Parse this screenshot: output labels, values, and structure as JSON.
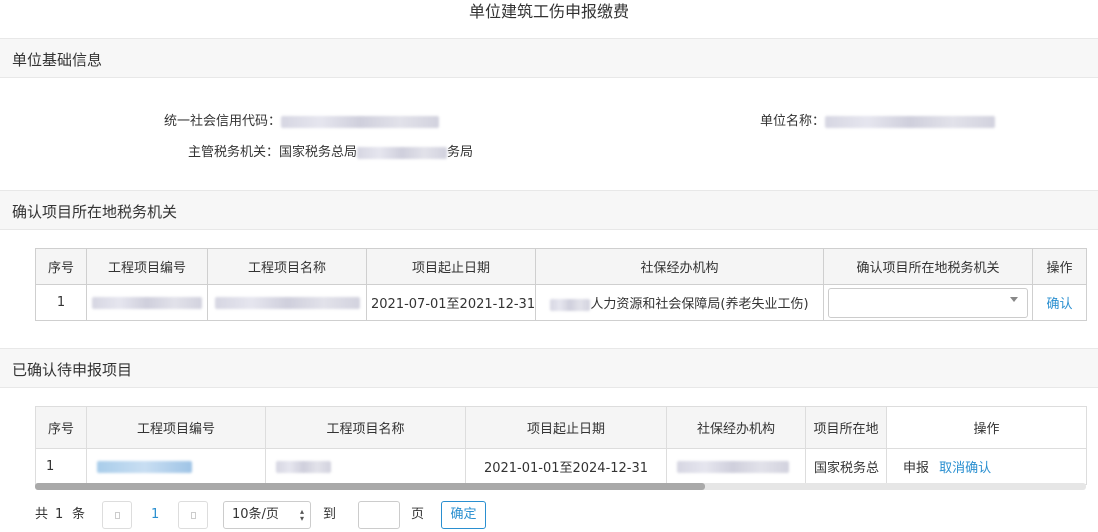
{
  "page_title": "单位建筑工伤申报缴费",
  "section_basic": {
    "title": "单位基础信息",
    "credit_code_label": "统一社会信用代码：",
    "unit_name_label": "单位名称：",
    "tax_authority_label": "主管税务机关：",
    "tax_authority_prefix": "国家税务总局",
    "tax_authority_suffix": "务局"
  },
  "section_confirm": {
    "title": "确认项目所在地税务机关",
    "columns": [
      "序号",
      "工程项目编号",
      "工程项目名称",
      "项目起止日期",
      "社保经办机构",
      "确认项目所在地税务机关",
      "操作"
    ],
    "row": {
      "index": "1",
      "date_range": "2021-07-01至2021-12-31",
      "agency_suffix": "人力资源和社会保障局(养老失业工伤)",
      "select_value": "",
      "action": "确认"
    }
  },
  "section_pending": {
    "title": "已确认待申报项目",
    "columns": [
      "序号",
      "工程项目编号",
      "工程项目名称",
      "项目起止日期",
      "社保经办机构",
      "项目所在地",
      "操作"
    ],
    "row": {
      "index": "1",
      "date_range": "2021-01-01至2024-12-31",
      "location": "国家税务总",
      "action_declare": "申报",
      "action_cancel": "取消确认"
    }
  },
  "pagination": {
    "total_prefix": "共",
    "total_count": "1",
    "total_suffix": "条",
    "current_page": "1",
    "page_size": "10条/页",
    "goto_label": "到第",
    "page_suffix": "页",
    "confirm_label": "确定"
  },
  "colors": {
    "link": "#2a8fd0",
    "header_bg": "#f7f7f7"
  }
}
